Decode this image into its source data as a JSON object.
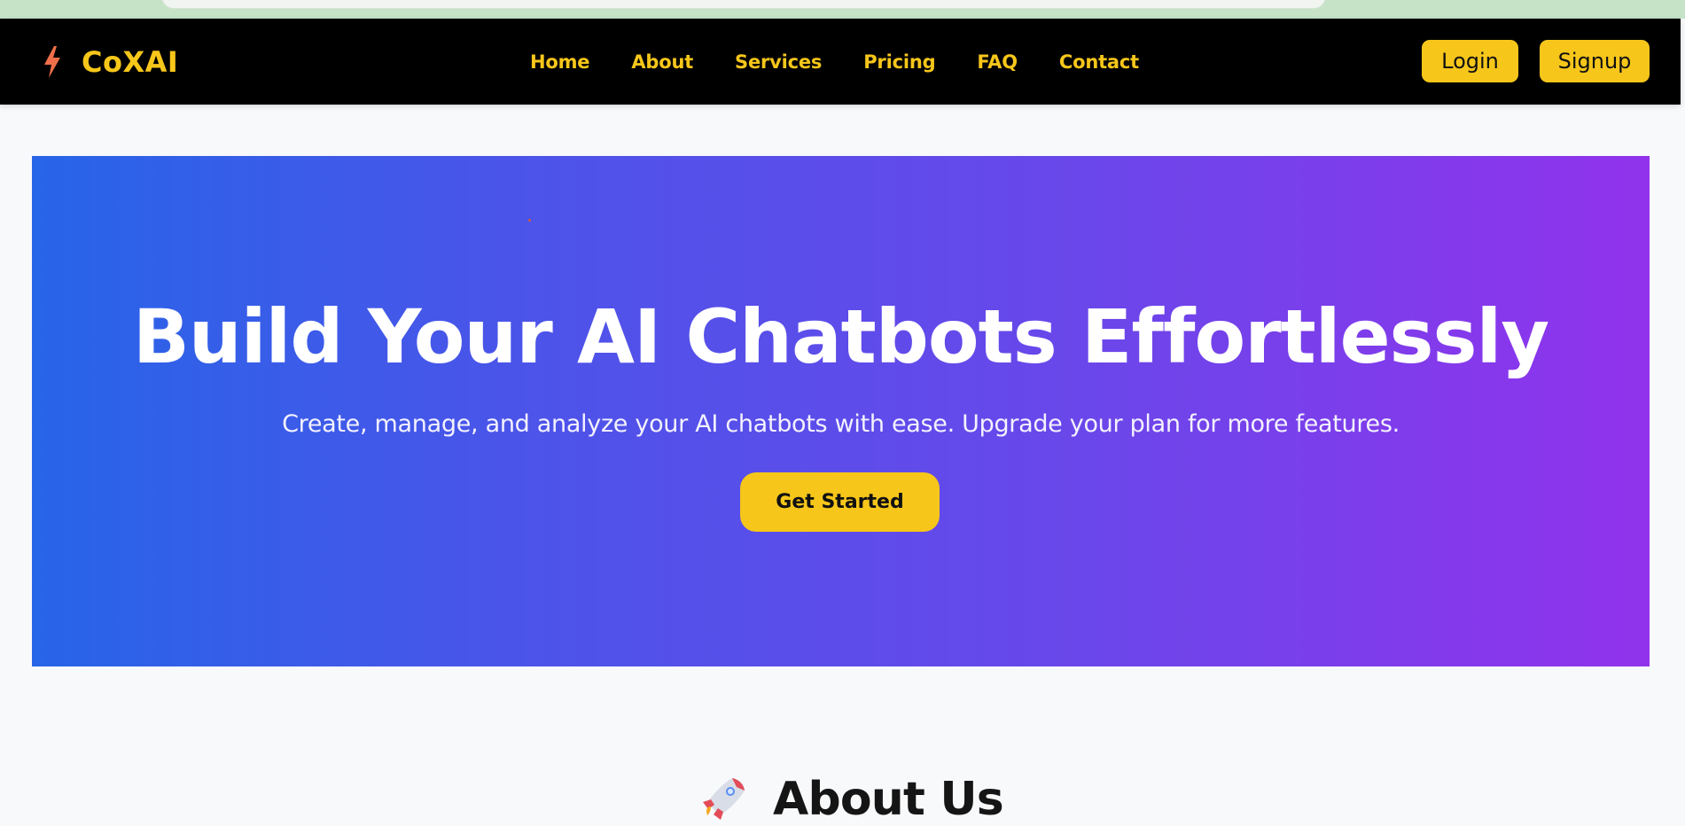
{
  "browser": {
    "strip_color": "#c6e3c7"
  },
  "navbar": {
    "brand": "CoXAI",
    "brand_icon": "lightning-bolt-icon",
    "links": [
      "Home",
      "About",
      "Services",
      "Pricing",
      "FAQ",
      "Contact"
    ],
    "login_label": "Login",
    "signup_label": "Signup",
    "accent_color": "#f6c61a"
  },
  "hero": {
    "title": "Build Your AI Chatbots Effortlessly",
    "subtitle": "Create, manage, and analyze your AI chatbots with ease. Upgrade your plan for more features.",
    "cta_label": "Get Started",
    "gradient_start": "#2765e8",
    "gradient_end": "#9133ec"
  },
  "about": {
    "title": "About Us",
    "icon": "rocket-icon"
  }
}
